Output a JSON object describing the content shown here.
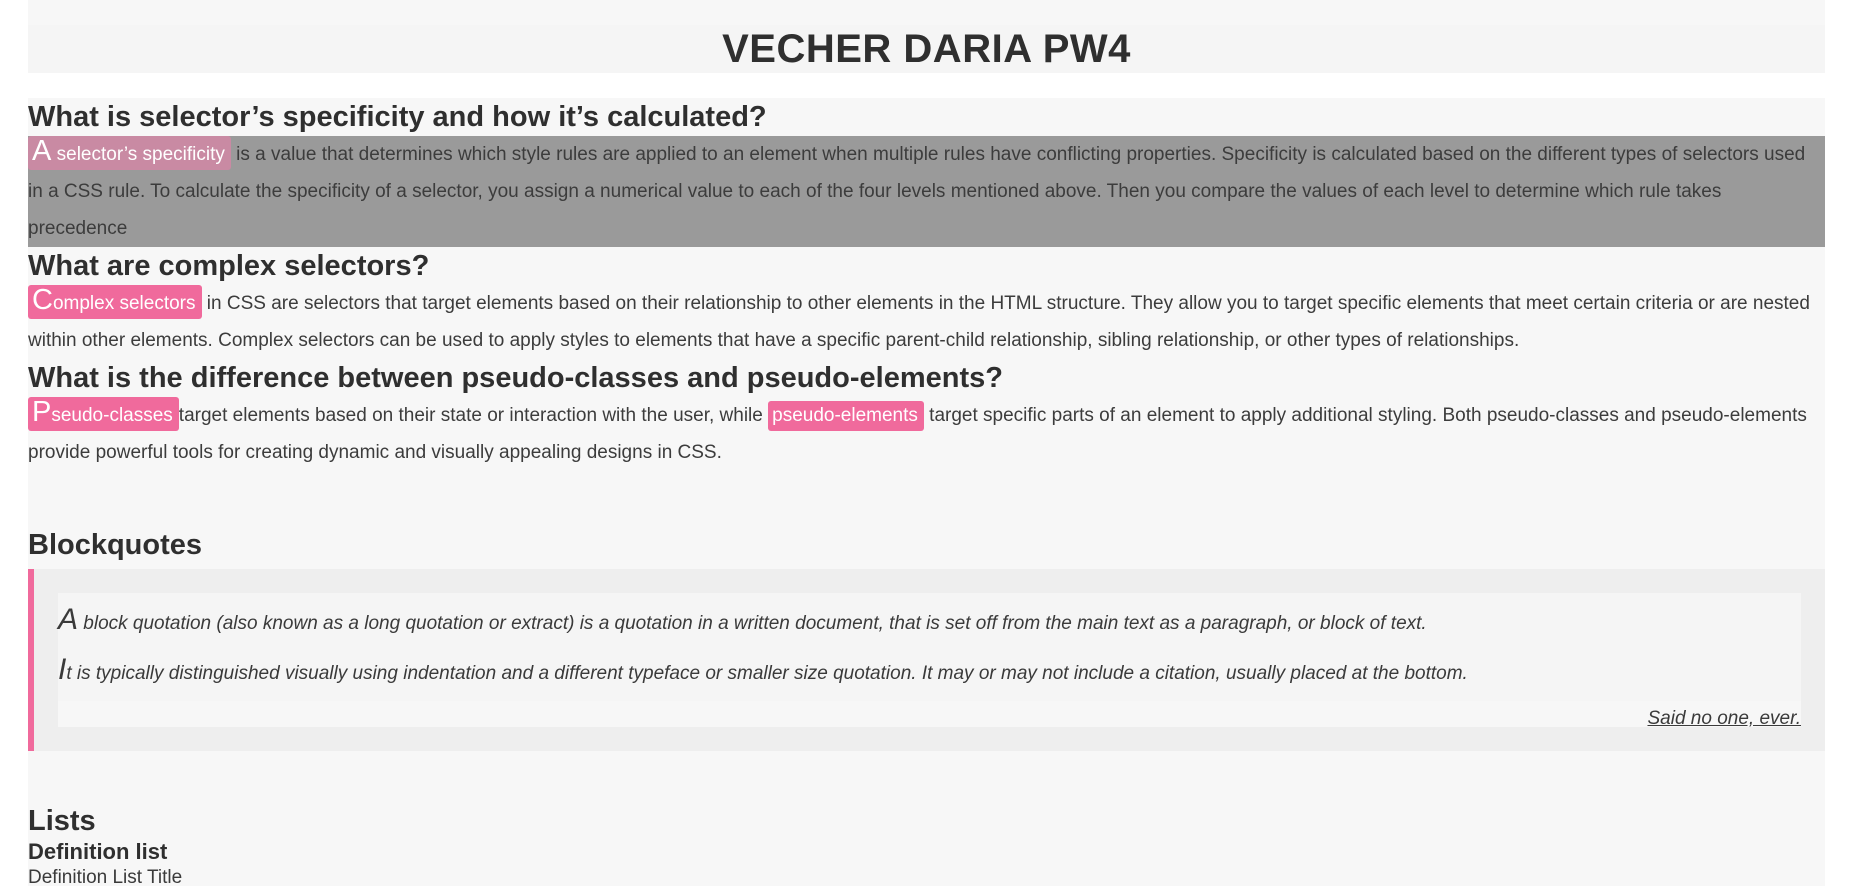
{
  "header": {
    "title": "VECHER DARIA PW4"
  },
  "sections": [
    {
      "question": "What is selector’s specificity and how it’s calculated?",
      "term_cap": "A",
      "term": " selector’s specificity",
      "text": " is a value that determines which style rules are applied to an element when multiple rules have conflicting properties. Specificity is calculated based on the different types of selectors used in a CSS rule. To calculate the specificity of a selector, you assign a numerical value to each of the four levels mentioned above. Then you compare the values of each level to determine which rule takes precedence"
    },
    {
      "question": "What are complex selectors?",
      "term_cap": "C",
      "term": "omplex selectors",
      "text": " in CSS are selectors that target elements based on their relationship to other elements in the HTML structure. They allow you to target specific elements that meet certain criteria or are nested within other elements. Complex selectors can be used to apply styles to elements that have a specific parent-child relationship, sibling relationship, or other types of relationships."
    },
    {
      "question": "What is the difference between pseudo-classes and pseudo-elements?",
      "term_cap": "P",
      "term": "seudo-classes",
      "text_before": "target elements based on their state or interaction with the user, while ",
      "term2": "pseudo-elements",
      "text_after": " target specific parts of an element to apply additional styling. Both pseudo-classes and pseudo-elements provide powerful tools for creating dynamic and visually appealing designs in CSS."
    }
  ],
  "blockquotes": {
    "heading": "Blockquotes",
    "lines": [
      {
        "cap": "A",
        "text": " block quotation (also known as a long quotation or extract) is a quotation in a written document, that is set off from the main text as a paragraph, or block of text."
      },
      {
        "cap": "I",
        "text": "t is typically distinguished visually using indentation and a different typeface or smaller size quotation. It may or may not include a citation, usually placed at the bottom."
      }
    ],
    "citation": "Said no one, ever."
  },
  "lists": {
    "heading": "Lists",
    "definition_heading": "Definition list",
    "definition_title": "Definition List Title"
  },
  "colors": {
    "accent": "#f06a9c",
    "highlight_block": "#9a9a9a",
    "page_bg": "#f7f7f7"
  }
}
